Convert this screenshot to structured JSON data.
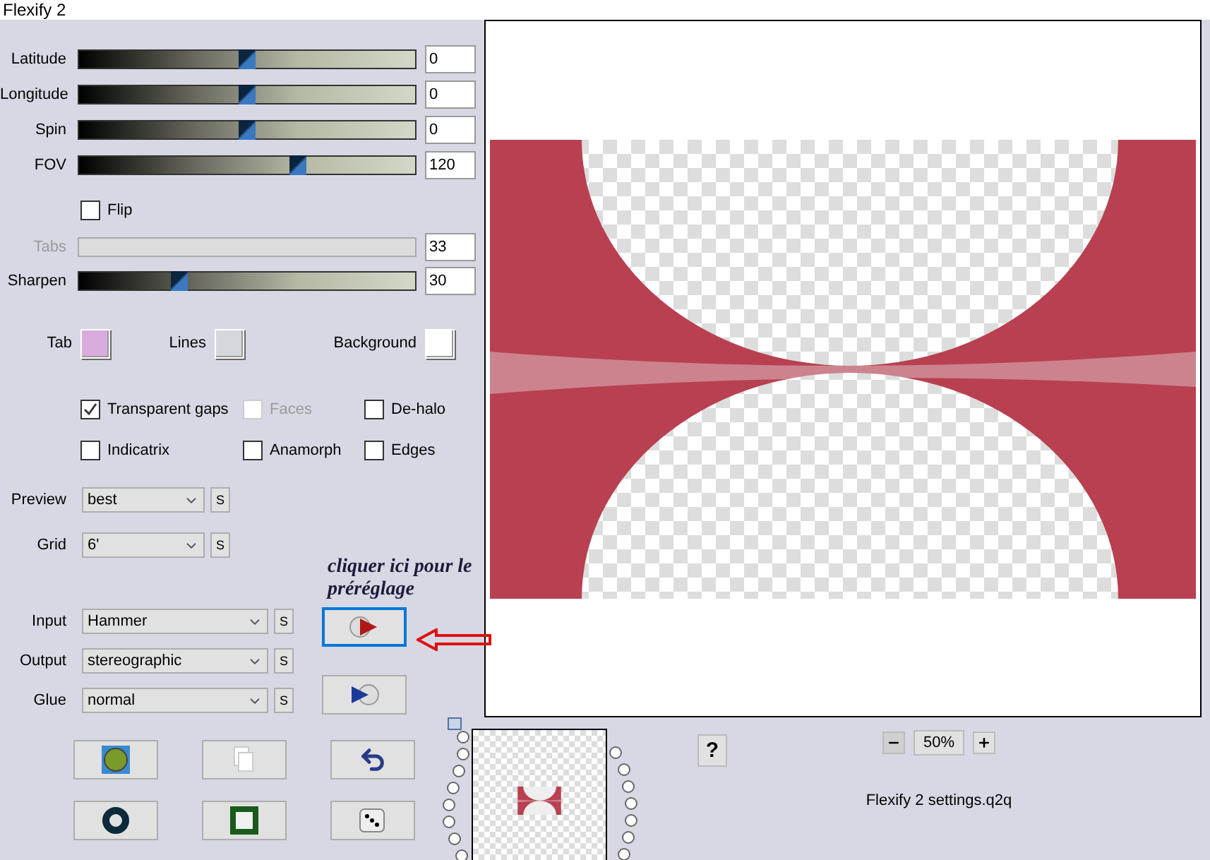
{
  "window": {
    "title": "Flexify 2"
  },
  "sliders": [
    {
      "label": "Latitude",
      "level": 0.5,
      "value": "0",
      "disabled": false
    },
    {
      "label": "Longitude",
      "level": 0.5,
      "value": "0",
      "disabled": false
    },
    {
      "label": "Spin",
      "level": 0.5,
      "value": "0",
      "disabled": false
    },
    {
      "label": "FOV",
      "level": 0.65,
      "value": "120",
      "disabled": false
    },
    {
      "label": "Tabs",
      "value": "33",
      "disabled": true
    },
    {
      "label": "Sharpen",
      "level": 0.3,
      "value": "30",
      "disabled": false
    }
  ],
  "flip": {
    "label": "Flip",
    "checked": false
  },
  "swatches": [
    {
      "label": "Tab",
      "color": "#d8acdc"
    },
    {
      "label": "Lines",
      "color": "#d4d8dc"
    },
    {
      "label": "Background",
      "color": "#ffffff"
    }
  ],
  "options": [
    {
      "label": "Transparent gaps",
      "checked": true,
      "disabled": false
    },
    {
      "label": "Faces",
      "checked": false,
      "disabled": true
    },
    {
      "label": "De-halo",
      "checked": false,
      "disabled": false
    },
    {
      "label": "Indicatrix",
      "checked": false,
      "disabled": false
    },
    {
      "label": "Anamorph",
      "checked": false,
      "disabled": false
    },
    {
      "label": "Edges",
      "checked": false,
      "disabled": false
    }
  ],
  "view_selects": [
    {
      "label": "Preview",
      "value": "best",
      "button": "S"
    },
    {
      "label": "Grid",
      "value": "6'",
      "button": "S"
    }
  ],
  "annotation": [
    "cliquer ici pour le",
    "préréglage"
  ],
  "mapping_selects": [
    {
      "label": "Input",
      "value": "Hammer",
      "button": "S"
    },
    {
      "label": "Output",
      "value": "stereographic",
      "button": "S"
    },
    {
      "label": "Glue",
      "value": "normal",
      "button": "S"
    }
  ],
  "preset_buttons": [
    {
      "kind": "load",
      "focused": true
    },
    {
      "kind": "save",
      "focused": false
    }
  ],
  "tool_buttons": [
    {
      "kind": "globe"
    },
    {
      "kind": "pages"
    },
    {
      "kind": "undo"
    },
    {
      "kind": "ring"
    },
    {
      "kind": "frame"
    },
    {
      "kind": "die"
    }
  ],
  "help": "?",
  "zoom": {
    "value": "50%"
  },
  "filename": "Flexify 2 settings.q2q"
}
